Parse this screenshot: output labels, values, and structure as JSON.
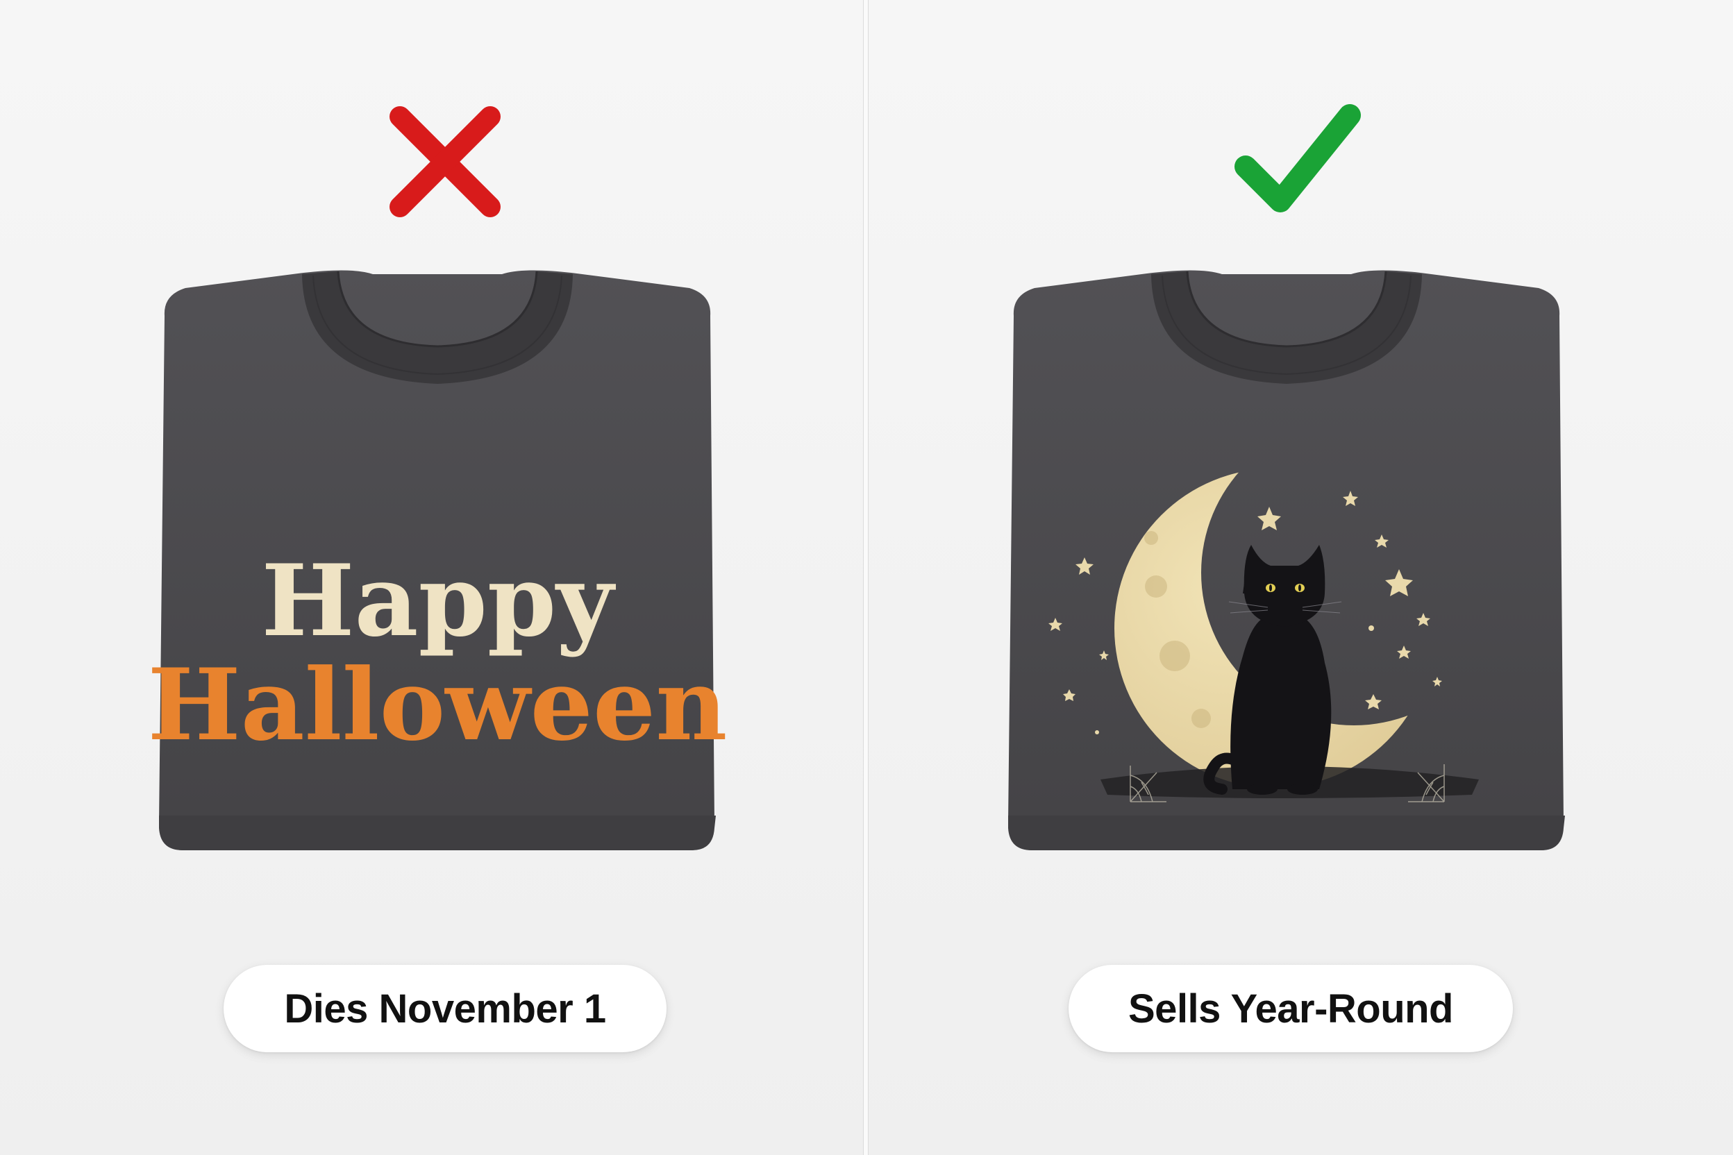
{
  "left": {
    "verdict_icon": "cross-icon",
    "verdict_color": "#d81b1b",
    "shirt_color": "#4a494c",
    "print": {
      "line1": "Happy",
      "line2": "Halloween",
      "line1_color": "#efe3c4",
      "line2_color": "#e8832e"
    },
    "caption": "Dies November 1"
  },
  "right": {
    "verdict_icon": "checkmark-icon",
    "verdict_color": "#1aa336",
    "shirt_color": "#4a494c",
    "print": {
      "subject": "black-cat-on-crescent-moon",
      "moon_color": "#e8d6a2",
      "star_color": "#e9d9ab"
    },
    "caption": "Sells Year-Round"
  }
}
